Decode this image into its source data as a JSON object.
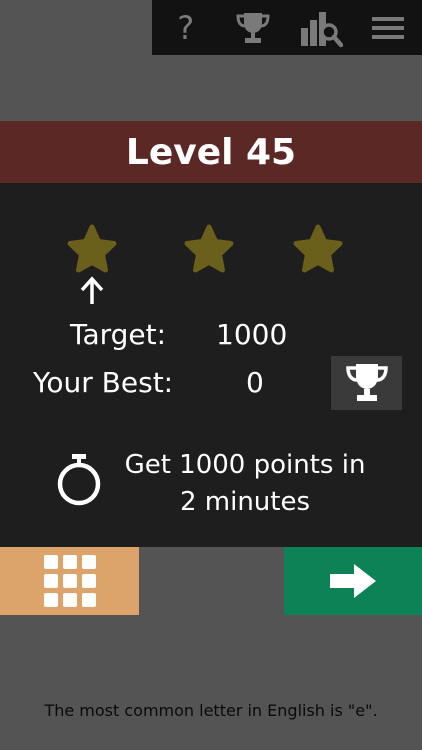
{
  "toolbar": {
    "icons": [
      "help-icon",
      "trophy-icon",
      "stats-icon",
      "menu-icon"
    ],
    "help_symbol": "?"
  },
  "level": {
    "title": "Level 45"
  },
  "stars": {
    "earned": 0,
    "total": 3,
    "color": "#6b5f1c",
    "arrow_icon": "arrow-up-icon"
  },
  "stats": {
    "target_label": "Target:",
    "target_value": "1000",
    "best_label": "Your Best:",
    "best_value": "0"
  },
  "goal": {
    "icon": "stopwatch-icon",
    "line1": "Get 1000 points in",
    "line2": "2 minutes"
  },
  "buttons": {
    "menu_icon": "grid-icon",
    "menu_color": "#dca46a",
    "next_icon": "arrow-right-icon",
    "next_color": "#0c8256"
  },
  "tip": {
    "text": "The most common letter in English is \"e\"."
  },
  "colors": {
    "background": "#545454",
    "panel": "#1e1e1e",
    "banner": "#5c2825",
    "toolbar": "#121212"
  }
}
